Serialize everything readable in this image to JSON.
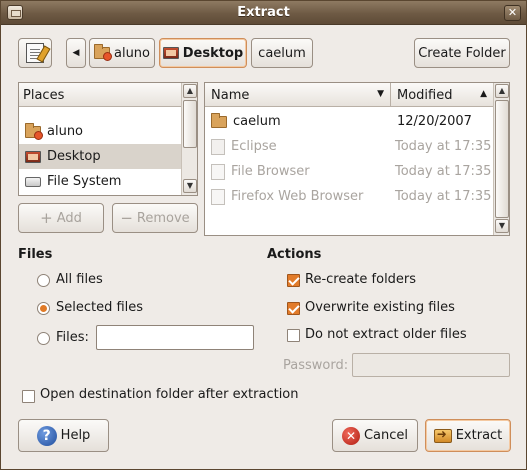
{
  "window": {
    "title": "Extract"
  },
  "pathbar": {
    "crumbs": [
      {
        "label": "aluno",
        "icon": "home-folder-icon"
      },
      {
        "label": "Desktop",
        "icon": "desktop-icon",
        "active": true
      },
      {
        "label": "caelum",
        "icon": ""
      }
    ],
    "create_folder_label": "Create Folder"
  },
  "places": {
    "header": "Places",
    "items": [
      {
        "label": "aluno",
        "icon": "home-folder-icon"
      },
      {
        "label": "Desktop",
        "icon": "desktop-icon",
        "selected": true
      },
      {
        "label": "File System",
        "icon": "drive-icon"
      }
    ],
    "add_label": "Add",
    "remove_label": "Remove"
  },
  "files": {
    "col_name": "Name",
    "col_modified": "Modified",
    "rows": [
      {
        "name": "caelum",
        "modified": "12/20/2007",
        "type": "folder",
        "dim": false
      },
      {
        "name": "Eclipse",
        "modified": "Today at 17:35",
        "type": "file",
        "dim": true
      },
      {
        "name": "File Browser",
        "modified": "Today at 17:35",
        "type": "file",
        "dim": true
      },
      {
        "name": "Firefox Web Browser",
        "modified": "Today at 17:35",
        "type": "file",
        "dim": true
      }
    ]
  },
  "files_section": {
    "title": "Files",
    "all_files": "All files",
    "selected_files": "Selected files",
    "files_label": "Files:",
    "files_value": "",
    "selected": "selected_files"
  },
  "actions_section": {
    "title": "Actions",
    "recreate_folders": "Re-create folders",
    "recreate_checked": true,
    "overwrite": "Overwrite existing files",
    "overwrite_checked": true,
    "no_older": "Do not extract older files",
    "no_older_checked": false,
    "password_label": "Password:"
  },
  "open_after": {
    "label": "Open destination folder after extraction",
    "checked": false
  },
  "buttons": {
    "help": "Help",
    "cancel": "Cancel",
    "extract": "Extract"
  }
}
